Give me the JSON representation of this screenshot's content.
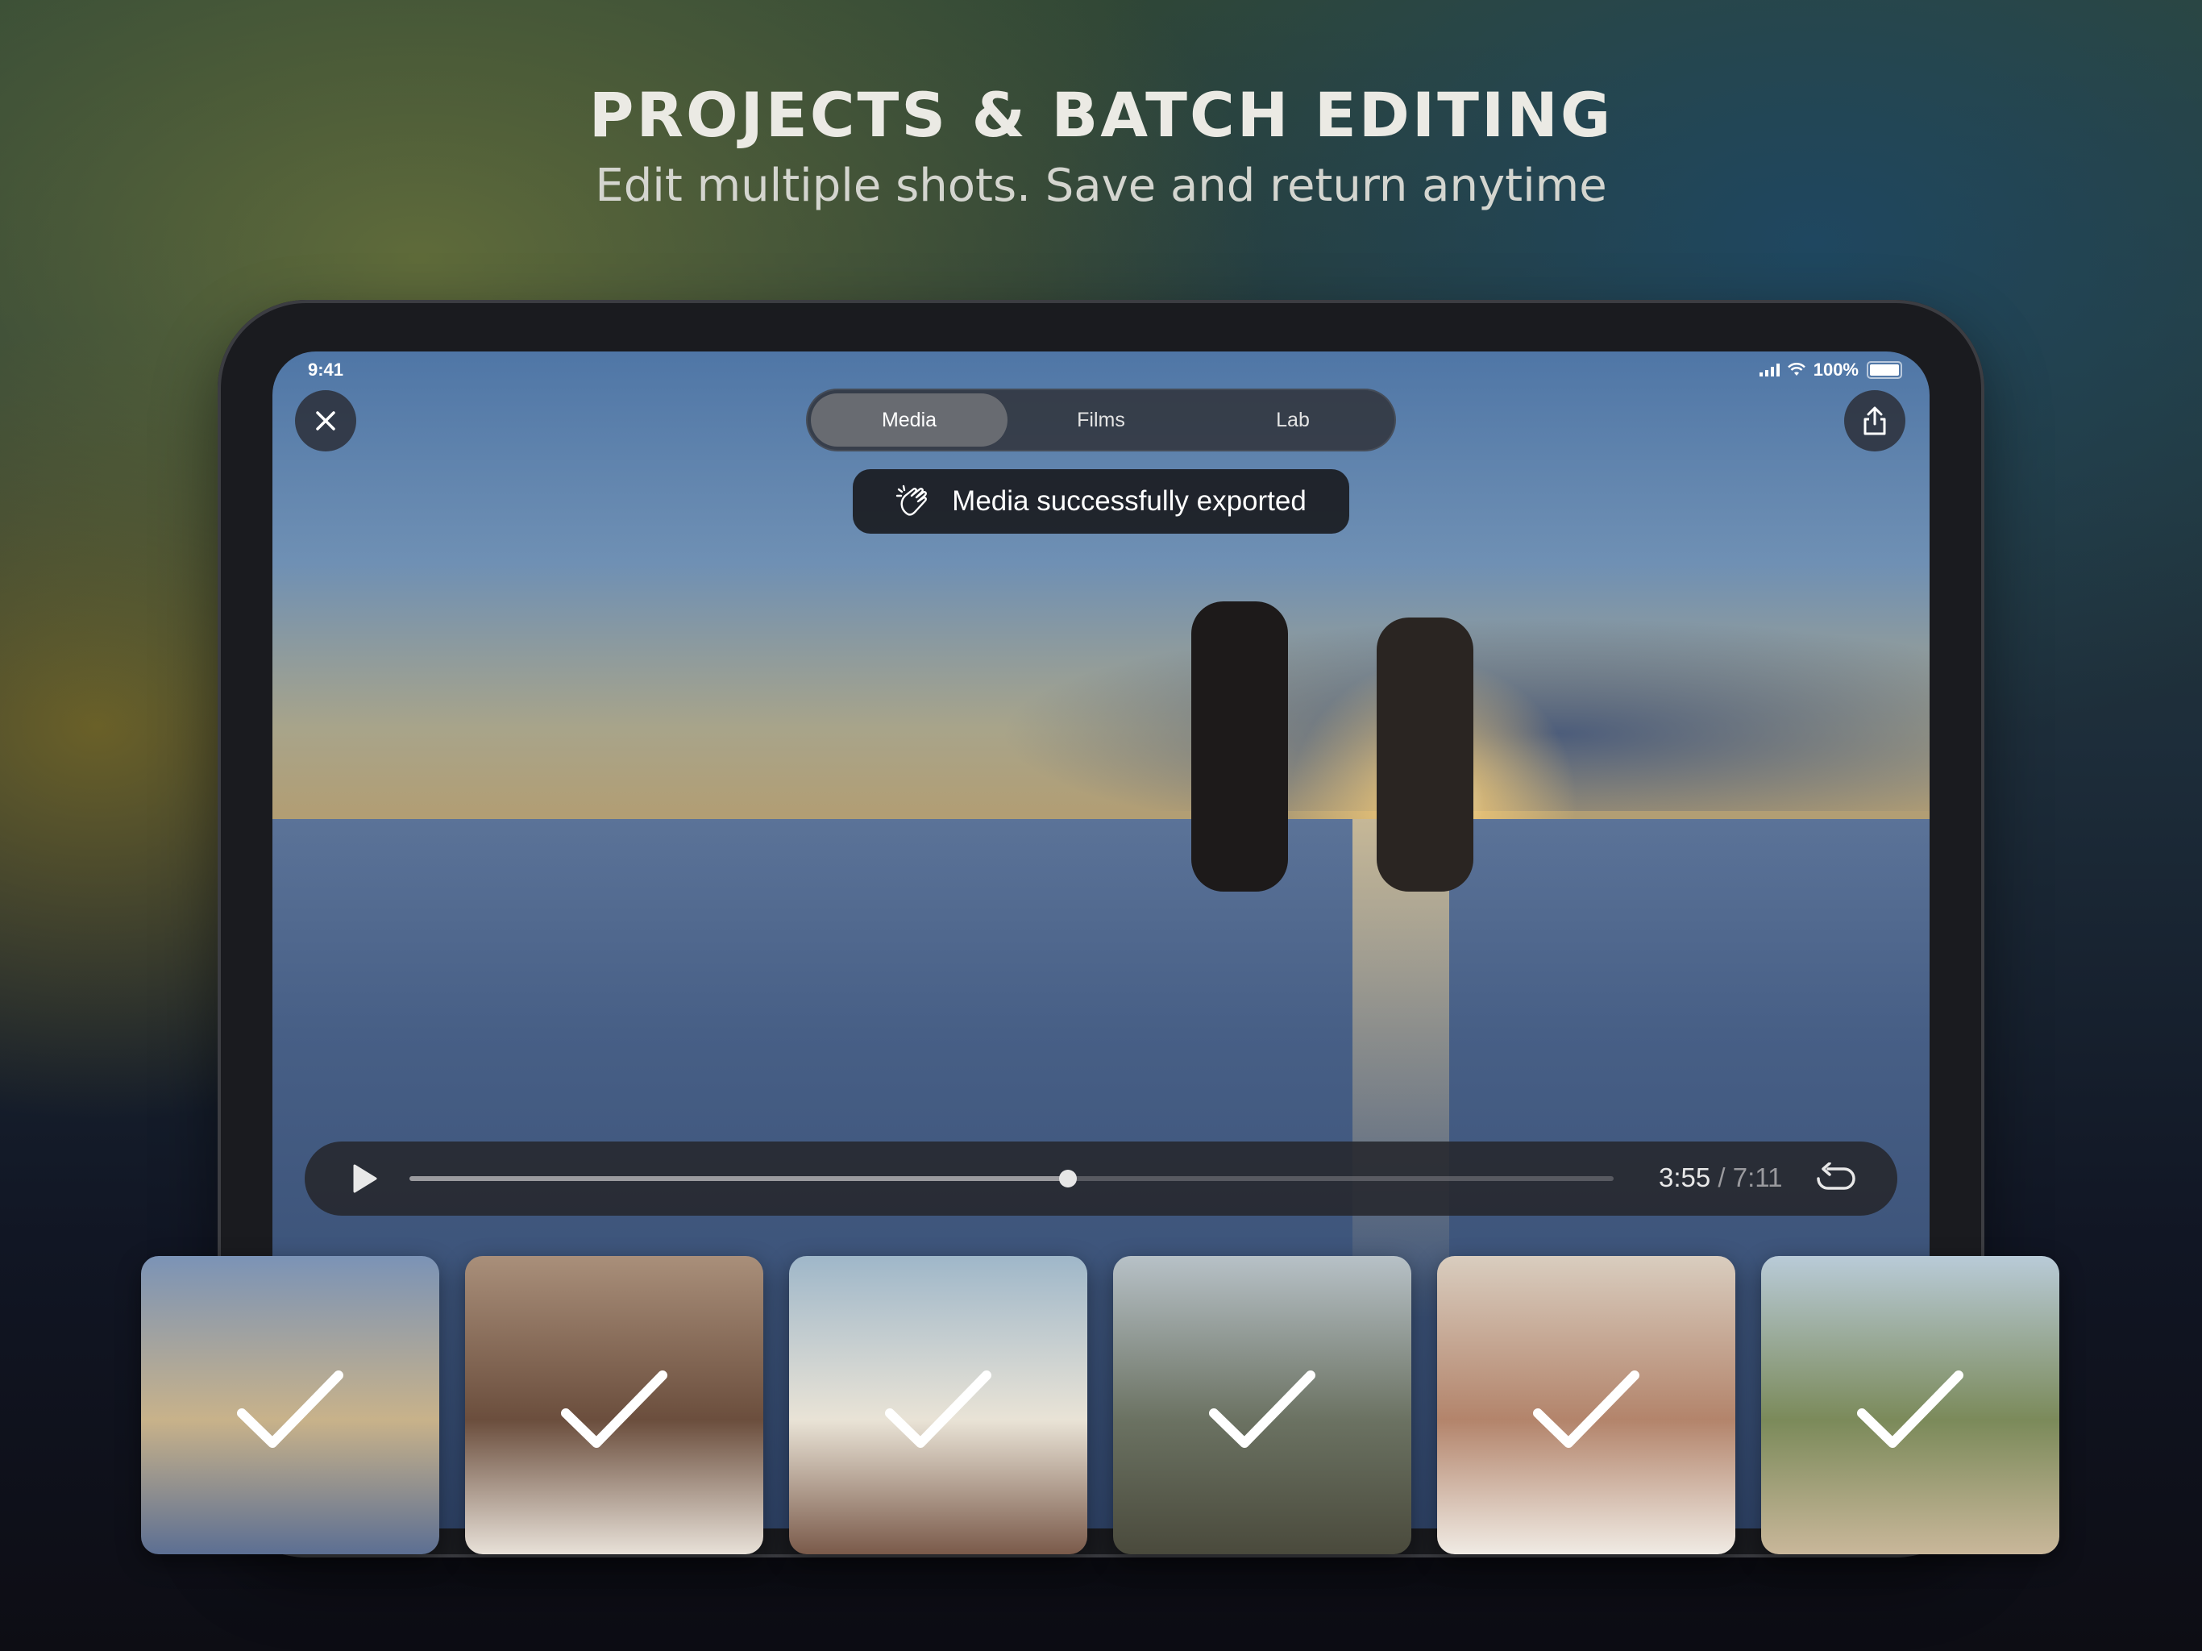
{
  "marketing": {
    "headline": "PROJECTS & BATCH EDITING",
    "subheadline": "Edit multiple shots. Save and return anytime"
  },
  "status_bar": {
    "time": "9:41",
    "battery": "100%"
  },
  "tabs": [
    {
      "label": "Media",
      "active": true
    },
    {
      "label": "Films",
      "active": false
    },
    {
      "label": "Lab",
      "active": false
    }
  ],
  "toast": {
    "message": "Media successfully exported",
    "icon": "clapping-hands-icon"
  },
  "player": {
    "current_time": "3:55",
    "separator": "/",
    "total_time": "7:11",
    "progress": 0.5467
  },
  "thumbnails": [
    {
      "name": "couple-running-sunset",
      "selected": true,
      "colors": [
        "#7b93b6",
        "#c8b28a",
        "#5c6f93"
      ]
    },
    {
      "name": "couple-rocks",
      "selected": true,
      "colors": [
        "#a98f7a",
        "#6b4e3d",
        "#e8e1d8"
      ]
    },
    {
      "name": "man-horse-rein",
      "selected": true,
      "colors": [
        "#9fb7c9",
        "#e9e3d6",
        "#7a5a4a"
      ]
    },
    {
      "name": "woman-balloon",
      "selected": true,
      "colors": [
        "#b7c1c7",
        "#6b7262",
        "#4a4a3c"
      ]
    },
    {
      "name": "hands-bracelet",
      "selected": true,
      "colors": [
        "#d9cdbf",
        "#b3846b",
        "#f0ebe4"
      ]
    },
    {
      "name": "riders-cliff",
      "selected": true,
      "colors": [
        "#b9cbd8",
        "#7b8a5a",
        "#c9b79a"
      ]
    }
  ],
  "colors": {
    "toast_bg": "#18191e",
    "segment_active": "#6e7076",
    "check": "#ffffff"
  }
}
